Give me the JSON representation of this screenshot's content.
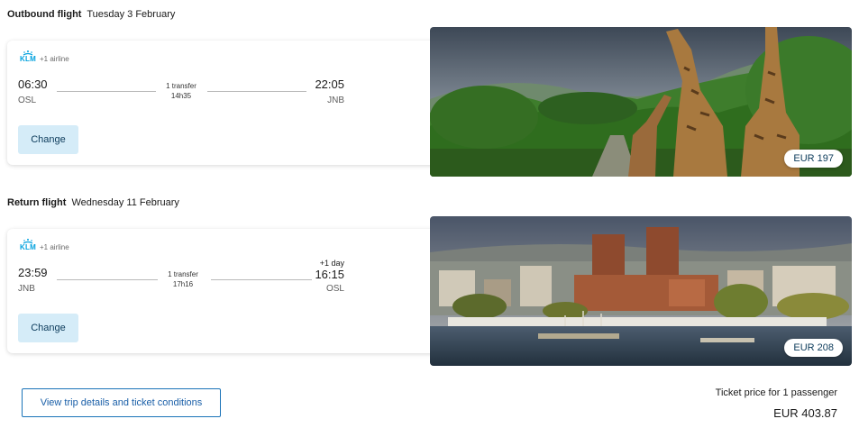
{
  "outbound": {
    "heading": "Outbound flight",
    "date": "Tuesday 3 February",
    "airline_logo_text": "KLM",
    "airline_extra": "+1 airline",
    "dep_time": "06:30",
    "dep_code": "OSL",
    "transfer": "1 transfer",
    "duration": "14h35",
    "arr_time": "22:05",
    "arr_code": "JNB",
    "change_label": "Change",
    "price_badge": "EUR 197",
    "photo_subject": "giraffes-savanna"
  },
  "return": {
    "heading": "Return flight",
    "date": "Wednesday 11 February",
    "airline_logo_text": "KLM",
    "airline_extra": "+1 airline",
    "dep_time": "23:59",
    "dep_code": "JNB",
    "transfer": "1 transfer",
    "duration": "17h16",
    "plus_day": "+1 day",
    "arr_time": "16:15",
    "arr_code": "OSL",
    "change_label": "Change",
    "price_badge": "EUR 208",
    "photo_subject": "oslo-harbour-city"
  },
  "footer": {
    "trip_details_label": "View trip details and ticket conditions",
    "price_label": "Ticket price for 1 passenger",
    "price_total": "EUR 403.87"
  },
  "colors": {
    "brand_blue": "#00a1de",
    "button_bg": "#d5ecf8",
    "link_blue": "#1a5fa8"
  }
}
